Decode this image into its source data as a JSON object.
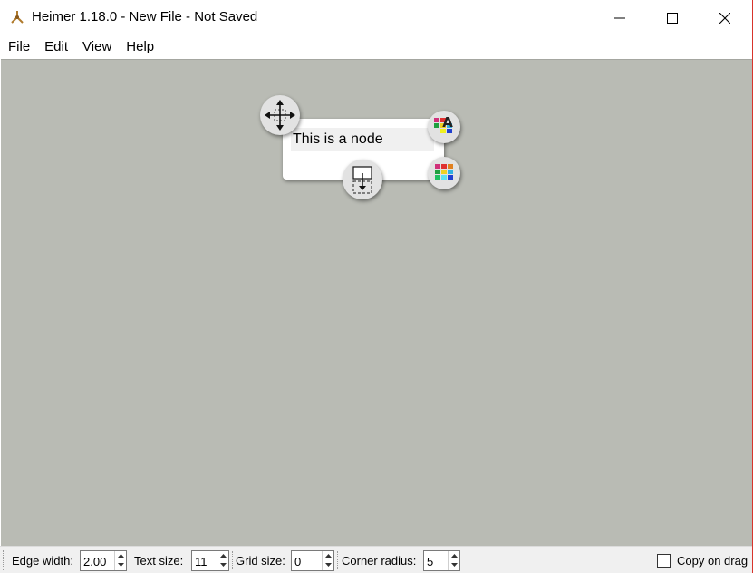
{
  "window": {
    "title": "Heimer 1.18.0 - New File - Not Saved"
  },
  "menu": {
    "items": [
      "File",
      "Edit",
      "View",
      "Help"
    ]
  },
  "node": {
    "text": "This is a node"
  },
  "toolbar": {
    "edge_width_label": "Edge width:",
    "edge_width_value": "2.00",
    "text_size_label": "Text size:",
    "text_size_value": "11",
    "grid_size_label": "Grid size:",
    "grid_size_value": "0",
    "corner_radius_label": "Corner radius:",
    "corner_radius_value": "5",
    "copy_on_drag_label": "Copy on drag"
  },
  "colors": {
    "canvas_background": "#b9bbb4",
    "node_background": "#ffffff",
    "handle_background": "#e2e2e2"
  }
}
